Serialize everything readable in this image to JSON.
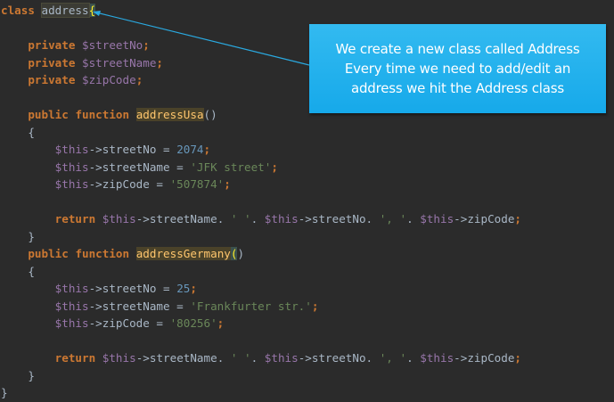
{
  "callout": {
    "text": "We create a new class called Address\nEvery time we need to add/edit an\naddress we hit the Address class",
    "color": "#1aaeeb"
  },
  "code": {
    "kw_class": "class",
    "class_name": "address",
    "open_brace": "{",
    "kw_private": "private",
    "prop_street_no": "$streetNo",
    "prop_street_name": "$streetName",
    "prop_zip_code": "$zipCode",
    "semicolon": ";",
    "kw_public": "public",
    "kw_function": "function",
    "fn_usa": "addressUsa",
    "fn_germany": "addressGermany",
    "parens": "()",
    "open_paren": "(",
    "close_paren": ")",
    "this": "$this",
    "arrow": "->",
    "field_street_no": "streetNo",
    "field_street_name": "streetName",
    "field_zip_code": "zipCode",
    "assign": " = ",
    "usa_street_no": "2074",
    "usa_street_name": "'JFK street'",
    "usa_zip": "'507874'",
    "de_street_no": "25",
    "de_street_name": "'Frankfurter str.'",
    "de_zip": "'80256'",
    "kw_return": "return",
    "dot": ". ",
    "str_space": "' '",
    "str_comma": "', '",
    "close_brace": "}"
  },
  "colors": {
    "background": "#2b2b2b",
    "keyword": "#cc7832",
    "variable": "#9876aa",
    "number": "#6897bb",
    "string": "#6a8759",
    "function": "#ffc66d",
    "default": "#a9b7c6"
  }
}
